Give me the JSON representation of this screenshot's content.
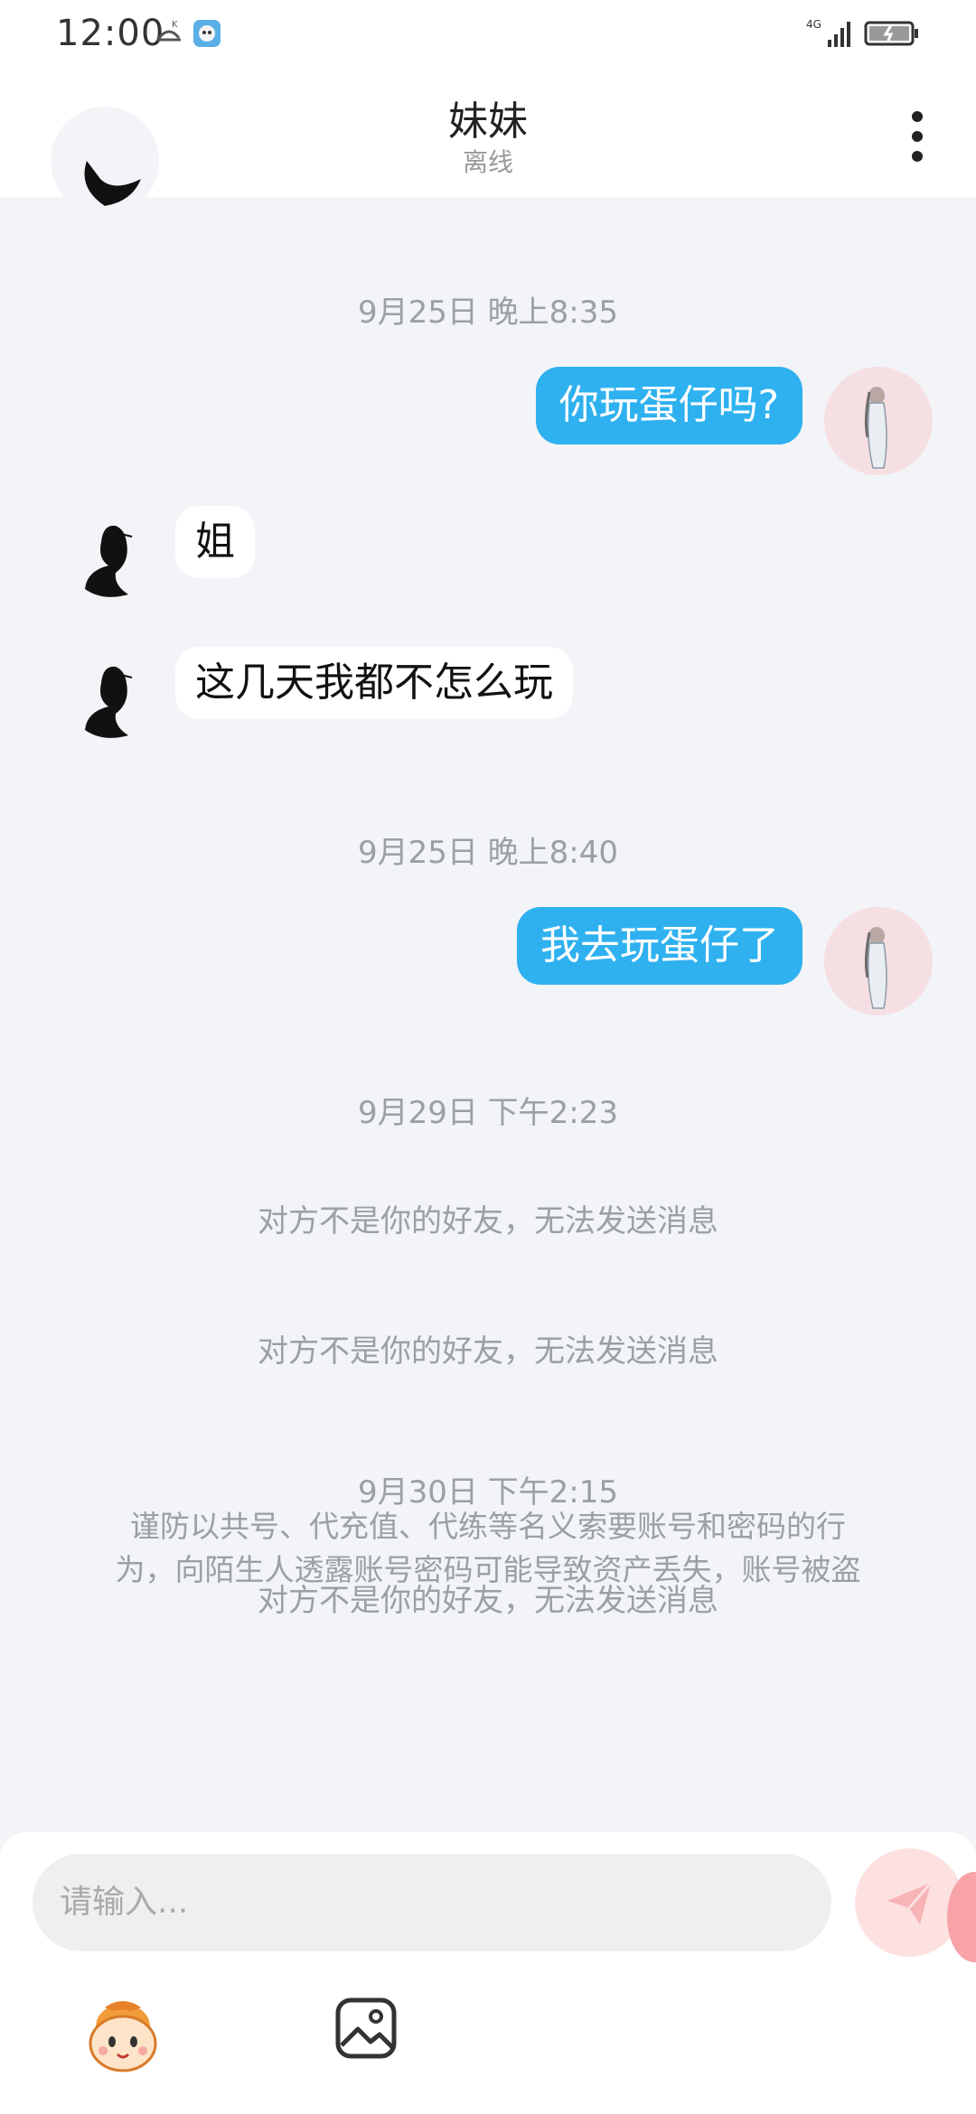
{
  "status_bar": {
    "time": "12:00",
    "network": "4G"
  },
  "header": {
    "title": "妹妹",
    "subtitle": "离线"
  },
  "chat": {
    "stamps": [
      "9月25日 晚上8:35",
      "9月25日 晚上8:40",
      "9月29日 下午2:23",
      "9月30日 下午2:15"
    ],
    "messages_out": [
      "你玩蛋仔吗?",
      "我去玩蛋仔了"
    ],
    "messages_in": [
      "姐",
      "这几天我都不怎么玩"
    ],
    "system_notices": [
      "对方不是你的好友，无法发送消息",
      "对方不是你的好友，无法发送消息",
      "对方不是你的好友，无法发送消息"
    ],
    "warning_line1": "谨防以共号、代充值、代练等名义索要账号和密码的行",
    "warning_line2": "为，向陌生人透露账号密码可能导致资产丢失，账号被盗"
  },
  "input": {
    "placeholder": "请输入..."
  },
  "colors": {
    "bubble_out": "#2fb1f0",
    "bubble_in": "#ffffff",
    "background": "#f2f4f7",
    "muted_text": "#9aa0a6"
  },
  "icons": {
    "back": "chevron-left-icon",
    "more": "more-vertical-icon",
    "send": "send-icon",
    "emoji": "emoji-avatar-icon",
    "image": "image-icon"
  }
}
